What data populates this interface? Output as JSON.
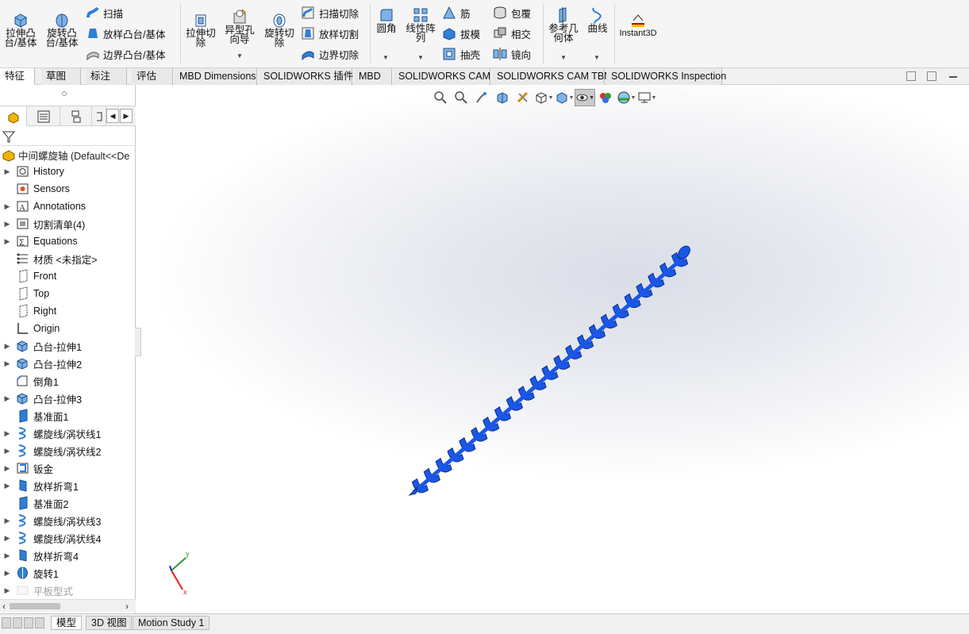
{
  "ribbon": {
    "extrude_boss": "拉伸凸\n台/基体",
    "revolve_boss": "旋转凸\n台/基体",
    "sweep": "扫描",
    "loft_boss": "放样凸台/基体",
    "boundary_boss": "边界凸台/基体",
    "extrude_cut": "拉伸切\n除",
    "hole_wizard": "异型孔\n向导",
    "revolve_cut": "旋转切\n除",
    "swept_cut": "扫描切除",
    "lofted_cut": "放样切割",
    "boundary_cut": "边界切除",
    "fillet": "圆角",
    "linear_pattern": "线性阵\n列",
    "rib": "筋",
    "draft": "拔模",
    "shell": "抽壳",
    "wrap": "包覆",
    "intersect": "相交",
    "mirror": "镜向",
    "ref_geometry": "参考几\n何体",
    "curves": "曲线",
    "instant3d": "Instant3D"
  },
  "tabs": [
    "特征",
    "草图",
    "标注",
    "评估",
    "MBD Dimensions",
    "SOLIDWORKS 插件",
    "MBD",
    "SOLIDWORKS CAM",
    "SOLIDWORKS CAM TBM",
    "SOLIDWORKS Inspection"
  ],
  "tree": {
    "title": "中间螺旋轴 (Default<<De",
    "items": [
      {
        "label": "History",
        "icon": "history-icon",
        "arrow": true
      },
      {
        "label": "Sensors",
        "icon": "sensor-icon",
        "arrow": false
      },
      {
        "label": "Annotations",
        "icon": "annotation-icon",
        "arrow": true
      },
      {
        "label": "切割清单(4)",
        "icon": "cut-list-icon",
        "arrow": true
      },
      {
        "label": "Equations",
        "icon": "equation-icon",
        "arrow": true
      },
      {
        "label": "材质 <未指定>",
        "icon": "material-icon",
        "arrow": false
      },
      {
        "label": "Front",
        "icon": "plane-icon",
        "arrow": false
      },
      {
        "label": "Top",
        "icon": "plane-icon",
        "arrow": false
      },
      {
        "label": "Right",
        "icon": "plane-icon",
        "arrow": false
      },
      {
        "label": "Origin",
        "icon": "origin-icon",
        "arrow": false
      },
      {
        "label": "凸台-拉伸1",
        "icon": "extrude-icon",
        "arrow": true
      },
      {
        "label": "凸台-拉伸2",
        "icon": "extrude-icon",
        "arrow": true
      },
      {
        "label": "倒角1",
        "icon": "chamfer-icon",
        "arrow": false
      },
      {
        "label": "凸台-拉伸3",
        "icon": "extrude-icon",
        "arrow": true
      },
      {
        "label": "基准面1",
        "icon": "ref-plane-icon",
        "arrow": false
      },
      {
        "label": "螺旋线/涡状线1",
        "icon": "helix-icon",
        "arrow": true
      },
      {
        "label": "螺旋线/涡状线2",
        "icon": "helix-icon",
        "arrow": true
      },
      {
        "label": "钣金",
        "icon": "sheet-metal-icon",
        "arrow": true
      },
      {
        "label": "放样折弯1",
        "icon": "lofted-bend-icon",
        "arrow": true
      },
      {
        "label": "基准面2",
        "icon": "ref-plane-icon",
        "arrow": false
      },
      {
        "label": "螺旋线/涡状线3",
        "icon": "helix-icon",
        "arrow": true
      },
      {
        "label": "螺旋线/涡状线4",
        "icon": "helix-icon",
        "arrow": true
      },
      {
        "label": "放样折弯4",
        "icon": "lofted-bend-icon",
        "arrow": true
      },
      {
        "label": "旋转1",
        "icon": "revolve-icon",
        "arrow": true
      },
      {
        "label": "平板型式",
        "icon": "flat-pattern-icon",
        "arrow": true,
        "dim": true
      }
    ]
  },
  "bottom_tabs": [
    "模型",
    "3D 视图",
    "Motion Study 1"
  ],
  "triad": {
    "y": "y",
    "x": "x"
  },
  "colors": {
    "model": "#1a57e8",
    "model_dark": "#0d2f8a",
    "accent": "#2f7fd8"
  }
}
